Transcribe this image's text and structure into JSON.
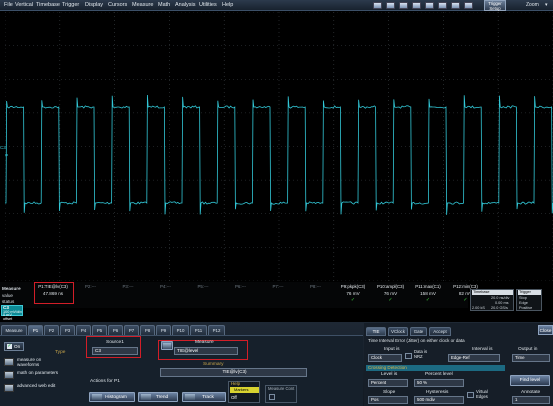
{
  "menubar": {
    "items": [
      "File",
      "Vertical",
      "Timebase",
      "Trigger",
      "Display",
      "Cursors",
      "Measure",
      "Math",
      "Analysis",
      "Utilities",
      "Help"
    ],
    "trigger_setup": "Trigger Setup",
    "zoom": "Zoom",
    "zoom_dropdown": "▾"
  },
  "channel_marker": "C3",
  "measure_table": {
    "row_labels": [
      "Measure",
      "value",
      "status"
    ],
    "columns": [
      {
        "header": "P1:TIE@lv(C3)",
        "value": "47.869 ns",
        "status": ""
      },
      {
        "header": "P2:---",
        "value": "",
        "status": ""
      },
      {
        "header": "P3:---",
        "value": "",
        "status": ""
      },
      {
        "header": "P4:---",
        "value": "",
        "status": ""
      },
      {
        "header": "P5:---",
        "value": "",
        "status": ""
      },
      {
        "header": "P6:---",
        "value": "",
        "status": ""
      },
      {
        "header": "P7:---",
        "value": "",
        "status": ""
      },
      {
        "header": "P8:---",
        "value": "",
        "status": ""
      },
      {
        "header": "P9:pkpk(C3)",
        "value": "76 mV",
        "status": "✓"
      },
      {
        "header": "P10:ampl(C3)",
        "value": "76 mV",
        "status": "✓"
      },
      {
        "header": "P11:max(C1)",
        "value": "158 mV",
        "status": "✓"
      },
      {
        "header": "P12:min(C3)",
        "value": "82 mV",
        "status": "✓"
      }
    ],
    "channel_badge": {
      "name": "C3",
      "line1": "100 mV/div",
      "line2": "0 mV offset"
    }
  },
  "timebase_box": {
    "title": "Timebase",
    "rows": [
      [
        "",
        "20.0 ns/div"
      ],
      [
        "",
        "0.00 ms"
      ],
      [
        "2.00 kS",
        "20.0 GS/s"
      ]
    ]
  },
  "trigger_box": {
    "title": "Trigger",
    "rows": [
      "Stop",
      "Edge",
      "Positive"
    ]
  },
  "tabs": [
    "Measure",
    "P1",
    "P2",
    "P3",
    "P4",
    "P5",
    "P6",
    "P7",
    "P8",
    "P9",
    "P10",
    "P11",
    "P12"
  ],
  "left": {
    "on_label": "On",
    "options": [
      "measure on waveforms",
      "math on parameters",
      "advanced web edit"
    ],
    "type_label": "Type",
    "source_label": "Source1",
    "source_value": "C3",
    "measure_label": "Measure",
    "measure_value": "TIE@level",
    "summary_label": "Summary",
    "summary_value": "TIE@lv(C3)",
    "actions_label": "Actions for P1",
    "buttons": [
      "Histogram",
      "Trend",
      "Track"
    ],
    "help_title": "Help",
    "help_markers": "Markers",
    "help_off": "Off",
    "measure_cont_title": "Measure Cont"
  },
  "right": {
    "tabs": [
      "TIE",
      "VClock",
      "Gate",
      "Accept"
    ],
    "description": "Time Interval Error (Jitter) on either clock or data",
    "input_is_label": "Input is",
    "input_is_value": "Clock",
    "data_is_nrz": "Data is NRZ",
    "interval_is_label": "Interval is",
    "interval_is_value": "Edge-Ref",
    "output_in_label": "Output in",
    "output_in_value": "Time",
    "crossing_title": "Crossing Detection",
    "level_is_label": "Level is",
    "level_is_value": "Percent",
    "percent_level_label": "Percent level",
    "percent_level_value": "50 %",
    "find_level": "Find level",
    "slope_label": "Slope",
    "slope_value": "Pos",
    "hysteresis_label": "Hysteresis",
    "hysteresis_value": "500 mdiv",
    "virtual_edges": "Virtual Edges",
    "annotate_label": "Annotate",
    "annotate_value": "1",
    "close": "Close"
  }
}
